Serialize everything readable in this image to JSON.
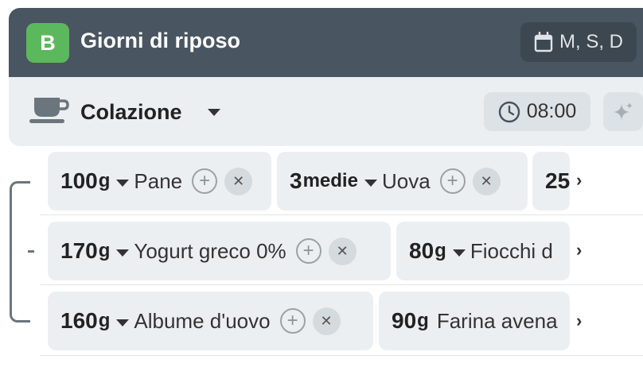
{
  "plan": {
    "badge": "B",
    "title": "Giorni di riposo",
    "days": "M, S, D",
    "days_icon": "calendar-icon"
  },
  "meal": {
    "icon": "coffee-cup-icon",
    "title": "Colazione",
    "time": "08:00",
    "time_icon": "clock-icon",
    "ai_icon": "sparkles-icon"
  },
  "rows": [
    {
      "items": [
        {
          "qty": "100",
          "unit": "g",
          "name": "Pane"
        },
        {
          "qty": "3",
          "unit": "medie",
          "name": "Uova"
        },
        {
          "qty": "25",
          "unit": "",
          "name": ""
        }
      ]
    },
    {
      "items": [
        {
          "qty": "170",
          "unit": "g",
          "name": "Yogurt greco 0%"
        },
        {
          "qty": "80",
          "unit": "g",
          "name": "Fiocchi d"
        }
      ]
    },
    {
      "items": [
        {
          "qty": "160",
          "unit": "g",
          "name": "Albume d'uovo"
        },
        {
          "qty": "90",
          "unit": "g",
          "name": "Farina avena"
        }
      ]
    }
  ],
  "more_glyph": "›",
  "plus_glyph": "+",
  "close_glyph": "✕"
}
